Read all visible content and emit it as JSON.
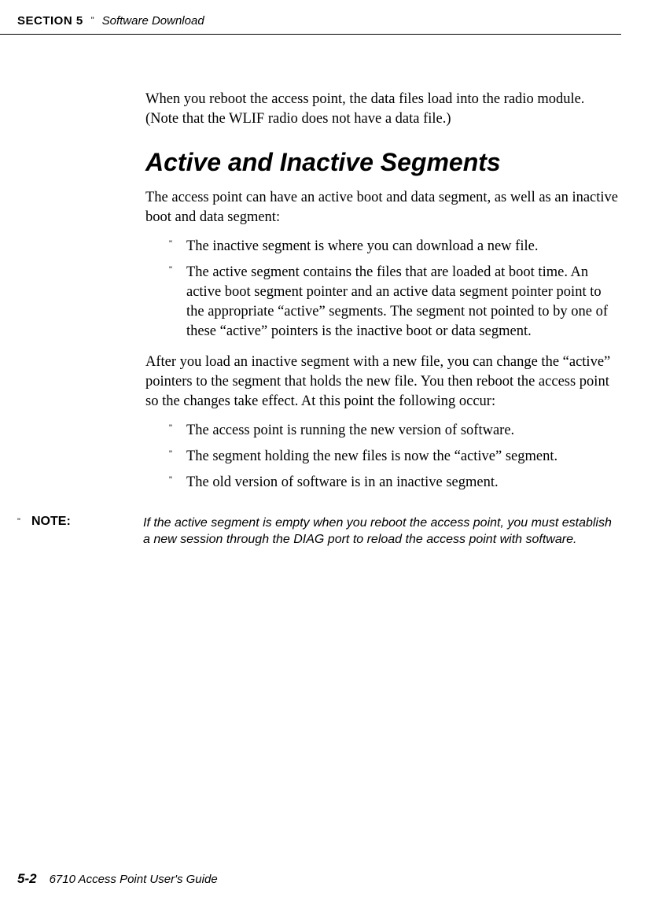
{
  "header": {
    "section": "SECTION 5",
    "title": "Software Download"
  },
  "intro_para": "When you reboot the access point, the data files load into the radio module.  (Note that the WLIF radio does not have a data file.)",
  "heading": "Active and Inactive Segments",
  "para1": "The access point can have an active boot and data segment, as well as an inactive boot and data segment:",
  "list1": {
    "item0": "The inactive segment is where you can download a new file.",
    "item1": "The active segment contains the files that are loaded at boot time.  An active boot segment pointer and an active data segment pointer point to the appropriate “active” segments.  The segment not pointed to by one of these “active” pointers is the inactive boot or data segment."
  },
  "para2": "After you load an inactive segment with a new file, you can change the “active” pointers to the segment that holds the new file.  You then reboot the access point so the changes take effect.  At this point the following occur:",
  "list2": {
    "item0": "The access point is running the new version of software.",
    "item1": "The segment holding the new files is now the “active” segment.",
    "item2": "The old version of software is in an inactive segment."
  },
  "note": {
    "label": "NOTE:",
    "text": "If the active segment is empty when you reboot the access point, you must establish a new session through the DIAG port to reload the access point with software."
  },
  "footer": {
    "page": "5-2",
    "title": "6710 Access Point User's Guide"
  }
}
